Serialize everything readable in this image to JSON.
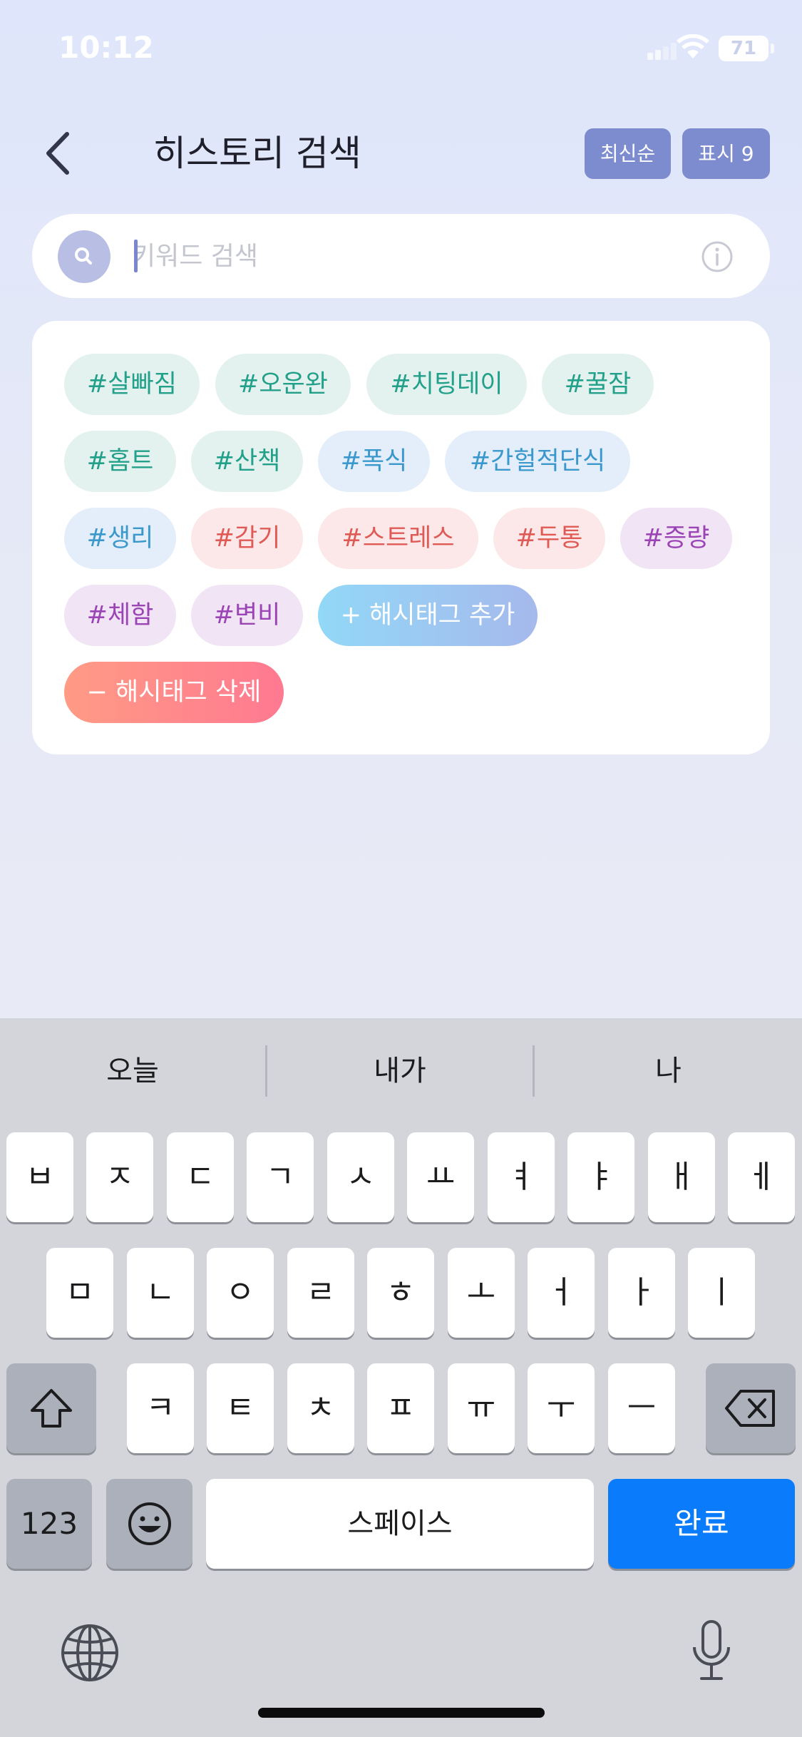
{
  "status_bar": {
    "time": "10:12",
    "battery": "71"
  },
  "header": {
    "title": "히스토리 검색",
    "sort_label": "최신순",
    "show_label": "표시 9"
  },
  "search": {
    "placeholder": "키워드 검색",
    "value": ""
  },
  "tags": [
    {
      "label": "#살빠짐",
      "color": "teal"
    },
    {
      "label": "#오운완",
      "color": "teal"
    },
    {
      "label": "#치팅데이",
      "color": "teal"
    },
    {
      "label": "#꿀잠",
      "color": "teal"
    },
    {
      "label": "#홈트",
      "color": "teal"
    },
    {
      "label": "#산책",
      "color": "teal"
    },
    {
      "label": "#폭식",
      "color": "blue"
    },
    {
      "label": "#간헐적단식",
      "color": "blue"
    },
    {
      "label": "#생리",
      "color": "blue"
    },
    {
      "label": "#감기",
      "color": "red"
    },
    {
      "label": "#스트레스",
      "color": "red"
    },
    {
      "label": "#두통",
      "color": "red"
    },
    {
      "label": "#증량",
      "color": "purple"
    },
    {
      "label": "#체함",
      "color": "purple"
    },
    {
      "label": "#변비",
      "color": "purple"
    }
  ],
  "tag_actions": {
    "add_label": "+ 해시태그 추가",
    "delete_label": "− 해시태그 삭제"
  },
  "tag_colors": {
    "teal": "#22a08a",
    "blue": "#3a98cc",
    "red": "#e05a55",
    "purple": "#9a44b6"
  },
  "keyboard": {
    "suggestions": [
      "오늘",
      "내가",
      "나"
    ],
    "row1": [
      "ㅂ",
      "ㅈ",
      "ㄷ",
      "ㄱ",
      "ㅅ",
      "ㅛ",
      "ㅕ",
      "ㅑ",
      "ㅐ",
      "ㅔ"
    ],
    "row2": [
      "ㅁ",
      "ㄴ",
      "ㅇ",
      "ㄹ",
      "ㅎ",
      "ㅗ",
      "ㅓ",
      "ㅏ",
      "ㅣ"
    ],
    "row3": [
      "ㅋ",
      "ㅌ",
      "ㅊ",
      "ㅍ",
      "ㅠ",
      "ㅜ",
      "ㅡ"
    ],
    "numbers_label": "123",
    "space_label": "스페이스",
    "done_label": "완료"
  },
  "accent_color": "#7d8ccf"
}
